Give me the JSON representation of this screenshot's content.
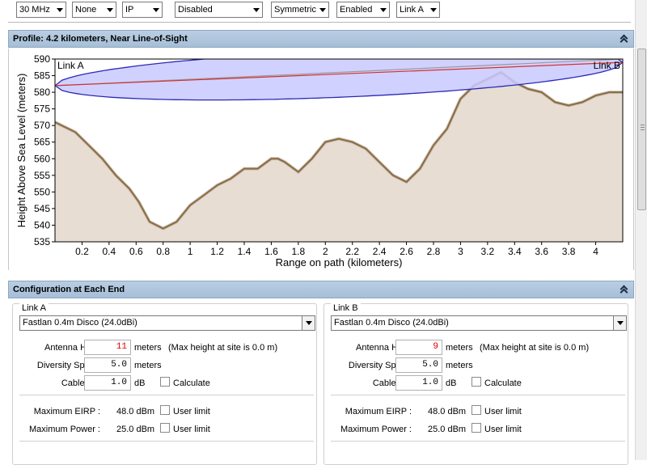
{
  "toolbar": {
    "selects": [
      {
        "id": "bandwidth",
        "value": "30 MHz"
      },
      {
        "id": "encryption",
        "value": "None"
      },
      {
        "id": "mode",
        "value": "IP"
      },
      {
        "id": "feature",
        "value": "Disabled"
      },
      {
        "id": "symmetry",
        "value": "Symmetric"
      },
      {
        "id": "state",
        "value": "Enabled"
      },
      {
        "id": "link",
        "value": "Link A"
      }
    ]
  },
  "profile": {
    "title": "Profile: 4.2 kilometers, Near Line-of-Sight"
  },
  "chart_data": {
    "type": "area",
    "xlabel": "Range on path (kilometers)",
    "ylabel": "Height Above Sea Level (meters)",
    "xlim": [
      0,
      4.2
    ],
    "ylim": [
      535,
      590
    ],
    "x_ticks": [
      "0.2",
      "0.4",
      "0.6",
      "0.8",
      "1",
      "1.2",
      "1.4",
      "1.6",
      "1.8",
      "2",
      "2.2",
      "2.4",
      "2.6",
      "2.8",
      "3",
      "3.2",
      "3.4",
      "3.6",
      "3.8",
      "4"
    ],
    "y_ticks": [
      "535",
      "540",
      "545",
      "550",
      "555",
      "560",
      "565",
      "570",
      "575",
      "580",
      "585",
      "590"
    ],
    "end_labels": {
      "left": "Link A",
      "right": "Link B"
    },
    "terrain": {
      "x": [
        0,
        0.15,
        0.25,
        0.35,
        0.45,
        0.55,
        0.62,
        0.7,
        0.8,
        0.9,
        1.0,
        1.1,
        1.2,
        1.3,
        1.4,
        1.5,
        1.6,
        1.65,
        1.7,
        1.8,
        1.9,
        2.0,
        2.1,
        2.2,
        2.3,
        2.4,
        2.5,
        2.6,
        2.7,
        2.8,
        2.9,
        3.0,
        3.1,
        3.2,
        3.3,
        3.4,
        3.5,
        3.6,
        3.7,
        3.8,
        3.9,
        4.0,
        4.1,
        4.2
      ],
      "y": [
        571,
        568,
        564,
        560,
        555,
        551,
        547,
        541,
        539,
        541,
        546,
        549,
        552,
        554,
        557,
        557,
        560,
        560,
        559,
        556,
        560,
        565,
        566,
        565,
        563,
        559,
        555,
        553,
        557,
        564,
        569,
        578,
        582,
        584,
        586,
        583,
        581,
        580,
        577,
        576,
        577,
        579,
        580,
        580
      ]
    },
    "line_of_sight": {
      "x": [
        0,
        4.2
      ],
      "y": [
        582,
        589
      ]
    },
    "grazing_line": {
      "x": [
        0,
        4.2
      ],
      "y": [
        582,
        590
      ]
    },
    "fresnel_zone": {
      "x": [
        0,
        4.2
      ],
      "center_y": [
        582,
        589
      ],
      "half_width_max": 7
    },
    "colors": {
      "terrain_fill": "#e8ddd2",
      "terrain_line": "#8b6b3f",
      "fresnel_fill": "#c9c9ff",
      "fresnel_stroke": "#2a2ab8",
      "los_line": "#d43030",
      "grazing_line": "#9a9a9a"
    }
  },
  "configuration": {
    "title": "Configuration at Each End",
    "links": [
      {
        "name": "Link A",
        "antenna": "Fastlan 0.4m Disco (24.0dBi)",
        "antenna_height_label": "Antenna Height :",
        "antenna_height": "11",
        "antenna_height_unit": "meters",
        "max_height_note": "(Max height at site is 0.0 m)",
        "diversity_label": "Diversity Spacing :",
        "diversity": "5.0",
        "diversity_unit": "meters",
        "cable_loss_label": "Cable Loss :",
        "cable_loss": "1.0",
        "cable_loss_unit": "dB",
        "calculate_label": "Calculate",
        "max_eirp_label": "Maximum EIRP :",
        "max_eirp": "48.0 dBm",
        "max_power_label": "Maximum Power :",
        "max_power": "25.0 dBm",
        "user_limit_label": "User limit"
      },
      {
        "name": "Link B",
        "antenna": "Fastlan 0.4m Disco (24.0dBi)",
        "antenna_height_label": "Antenna Height :",
        "antenna_height": "9",
        "antenna_height_unit": "meters",
        "max_height_note": "(Max height at site is 0.0 m)",
        "diversity_label": "Diversity Spacing :",
        "diversity": "5.0",
        "diversity_unit": "meters",
        "cable_loss_label": "Cable Loss :",
        "cable_loss": "1.0",
        "cable_loss_unit": "dB",
        "calculate_label": "Calculate",
        "max_eirp_label": "Maximum EIRP :",
        "max_eirp": "48.0 dBm",
        "max_power_label": "Maximum Power :",
        "max_power": "25.0 dBm",
        "user_limit_label": "User limit"
      }
    ]
  }
}
